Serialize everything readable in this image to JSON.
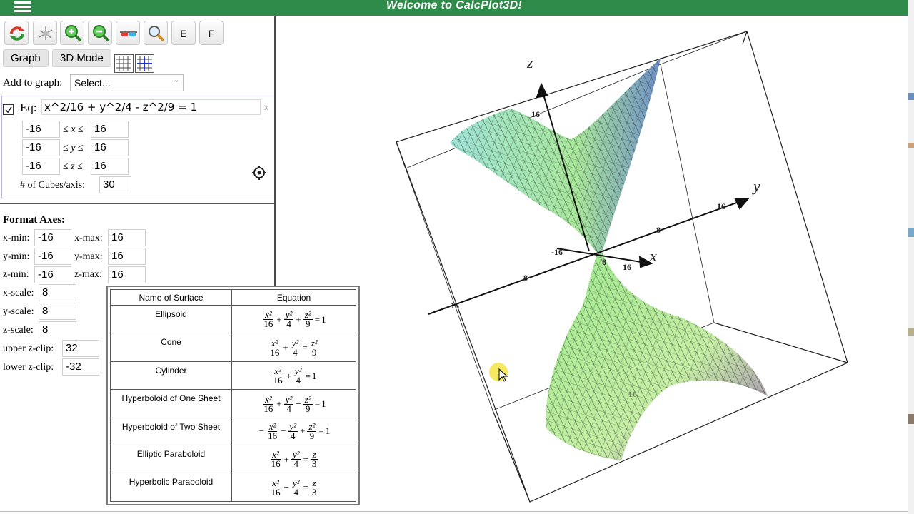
{
  "header": {
    "title": "Welcome to CalcPlot3D!"
  },
  "toolbar": {
    "buttons": [
      {
        "icon": "refresh-icon"
      },
      {
        "icon": "axes-orientation-icon"
      },
      {
        "icon": "zoom-in-icon"
      },
      {
        "icon": "zoom-out-icon"
      },
      {
        "icon": "3d-glasses-icon"
      },
      {
        "icon": "magnifier-icon"
      },
      {
        "label": "E"
      },
      {
        "label": "F"
      }
    ]
  },
  "tabs": {
    "graph": "Graph",
    "mode3d": "3D Mode"
  },
  "add_to_graph": {
    "label": "Add to graph:",
    "value": "Select..."
  },
  "equation": {
    "label": "Eq:",
    "value": "x^2/16 + y^2/4 - z^2/9 = 1",
    "close": "x",
    "x_min": "-16",
    "x_max": "16",
    "y_min": "-16",
    "y_max": "16",
    "z_min": "-16",
    "z_max": "16",
    "range_op": "≤",
    "cubes_label": "# of Cubes/axis:",
    "cubes_value": "30"
  },
  "format_axes": {
    "title": "Format Axes:",
    "x_min_label": "x-min:",
    "x_min": "-16",
    "x_max_label": "x-max:",
    "x_max": "16",
    "y_min_label": "y-min:",
    "y_min": "-16",
    "y_max_label": "y-max:",
    "y_max": "16",
    "z_min_label": "z-min:",
    "z_min": "-16",
    "z_max_label": "z-max:",
    "z_max": "16",
    "x_scale_label": "x-scale:",
    "x_scale": "8",
    "y_scale_label": "y-scale:",
    "y_scale": "8",
    "z_scale_label": "z-scale:",
    "z_scale": "8",
    "upper_clip_label": "upper z-clip:",
    "upper_clip": "32",
    "lower_clip_label": "lower z-clip:",
    "lower_clip": "-32"
  },
  "surface_table": {
    "headers": [
      "Name of Surface",
      "Equation"
    ],
    "rows": [
      {
        "name": "Ellipsoid",
        "terms": [
          [
            "",
            "x²",
            "16"
          ],
          [
            "+",
            "y²",
            "4"
          ],
          [
            "+",
            "z²",
            "9"
          ]
        ],
        "rhs": "1"
      },
      {
        "name": "Cone",
        "terms": [
          [
            "",
            "x²",
            "16"
          ],
          [
            "+",
            "y²",
            "4"
          ]
        ],
        "rhs_frac": [
          "z²",
          "9"
        ]
      },
      {
        "name": "Cylinder",
        "terms": [
          [
            "",
            "x²",
            "16"
          ],
          [
            "+",
            "y²",
            "4"
          ]
        ],
        "rhs": "1"
      },
      {
        "name": "Hyperboloid of One Sheet",
        "terms": [
          [
            "",
            "x²",
            "16"
          ],
          [
            "+",
            "y²",
            "4"
          ],
          [
            "−",
            "z²",
            "9"
          ]
        ],
        "rhs": "1"
      },
      {
        "name": "Hyperboloid of Two Sheet",
        "terms": [
          [
            "−",
            "x²",
            "16"
          ],
          [
            "−",
            "y²",
            "4"
          ],
          [
            "+",
            "z²",
            "9"
          ]
        ],
        "rhs": "1"
      },
      {
        "name": "Elliptic Paraboloid",
        "terms": [
          [
            "",
            "x²",
            "16"
          ],
          [
            "+",
            "y²",
            "4"
          ]
        ],
        "rhs_frac": [
          "z",
          "3"
        ]
      },
      {
        "name": "Hyperbolic Paraboloid",
        "terms": [
          [
            "",
            "x²",
            "16"
          ],
          [
            "−",
            "y²",
            "4"
          ]
        ],
        "rhs_frac": [
          "z",
          "3"
        ]
      }
    ]
  },
  "plot": {
    "axis_labels": {
      "x": "x",
      "y": "y",
      "z": "z"
    },
    "ticks": {
      "z_16": "16",
      "y_16": "16",
      "y_8": "8",
      "x_neg16": "-16",
      "x_8": "8",
      "x_16": "16",
      "y_neg8": "8",
      "y_neg16": "-16",
      "bottom_16": "16"
    },
    "colors": {
      "frame": "#222222",
      "surface_cyan": "#9fe3d8",
      "surface_green": "#9be88c",
      "surface_purple": "#a277b8",
      "mesh": "#1a2a22"
    }
  }
}
